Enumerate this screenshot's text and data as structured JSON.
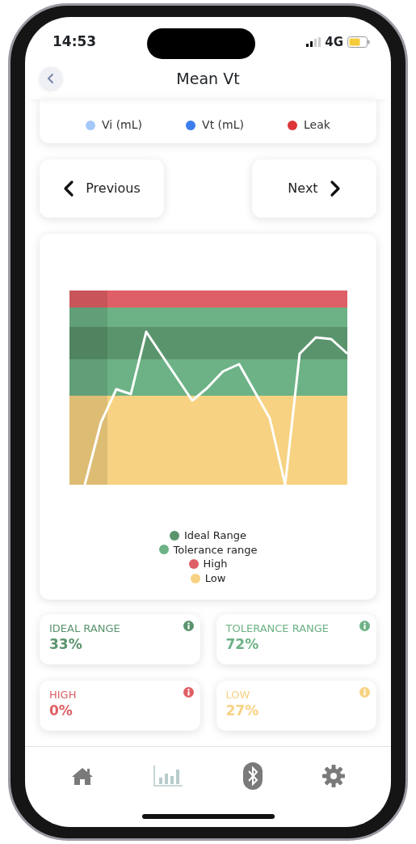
{
  "status_bar": {
    "time": "14:53",
    "network": "4G"
  },
  "header": {
    "title": "Mean Vt"
  },
  "series_legend": [
    {
      "label": "Vi (mL)",
      "color": "#a4c8f8"
    },
    {
      "label": "Vt (mL)",
      "color": "#3b7ded"
    },
    {
      "label": "Leak",
      "color": "#dd3539"
    }
  ],
  "pager": {
    "previous": "Previous",
    "next": "Next"
  },
  "range_legend": [
    {
      "label": "Ideal Range",
      "color": "#5a946d"
    },
    {
      "label": "Tolerance range",
      "color": "#6cb286"
    },
    {
      "label": "High",
      "color": "#de5f65"
    },
    {
      "label": "Low",
      "color": "#f6d282"
    }
  ],
  "stats": [
    {
      "label": "IDEAL RANGE",
      "value": "33%",
      "color": "#5a946d"
    },
    {
      "label": "TOLERANCE RANGE",
      "value": "72%",
      "color": "#6cb286"
    },
    {
      "label": "HIGH",
      "value": "0%",
      "color": "#de5f65"
    },
    {
      "label": "LOW",
      "value": "27%",
      "color": "#f6d282"
    }
  ],
  "nav": [
    {
      "kind": "home",
      "selected": false
    },
    {
      "kind": "chart",
      "selected": true
    },
    {
      "kind": "bluetooth",
      "selected": false
    },
    {
      "kind": "settings",
      "selected": false
    }
  ]
}
